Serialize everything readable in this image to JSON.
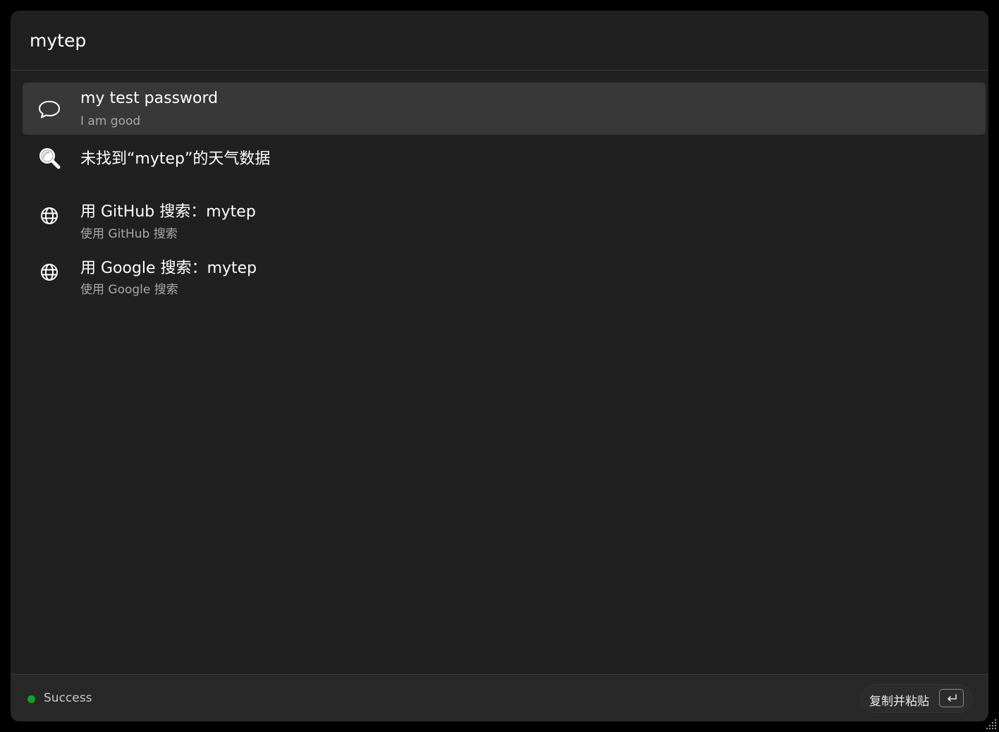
{
  "search": {
    "value": "mytep"
  },
  "results": [
    {
      "icon": "chat-bubble-icon",
      "title": "my test password",
      "subtitle": "I am good",
      "selected": true
    },
    {
      "icon": "weather-search-icon",
      "title": "未找到“mytep”的天气数据",
      "subtitle": "",
      "selected": false
    },
    {
      "icon": "globe-icon",
      "title": "用 GitHub 搜索：mytep",
      "subtitle": "使用 GitHub 搜索",
      "selected": false
    },
    {
      "icon": "globe-icon",
      "title": "用 Google 搜索：mytep",
      "subtitle": "使用 Google 搜索",
      "selected": false
    }
  ],
  "footer": {
    "status_text": "Success",
    "status_color": "#16a02a",
    "action_label": "复制并粘贴",
    "action_key_icon": "enter-key-icon"
  },
  "colors": {
    "window_bg": "#202020",
    "selected_bg": "#383838",
    "footer_bg": "#282828"
  }
}
